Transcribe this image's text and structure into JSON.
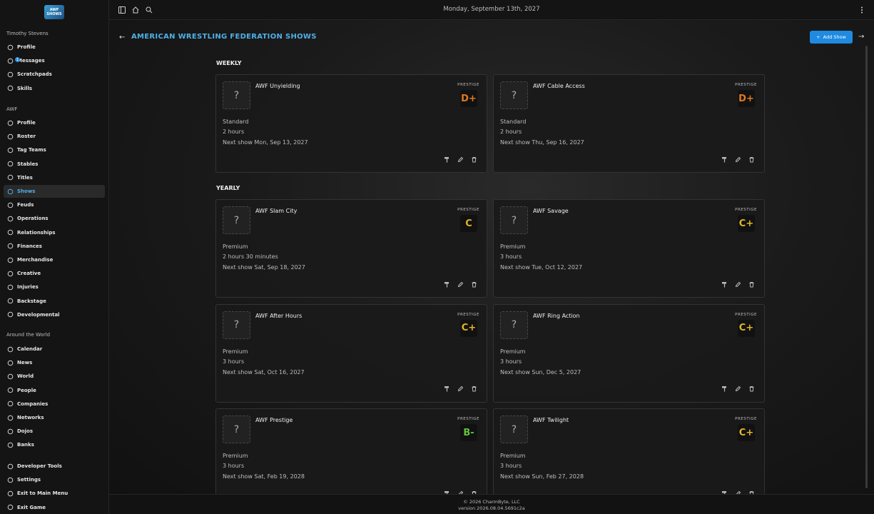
{
  "logo_text": "AWF SHOWS",
  "user_name": "Timothy Stevens",
  "user_nav": [
    {
      "icon": "person-icon",
      "label": "Profile"
    },
    {
      "icon": "chat-icon",
      "label": "Messages",
      "badge": "1"
    },
    {
      "icon": "notepad-icon",
      "label": "Scratchpads"
    },
    {
      "icon": "star-icon",
      "label": "Skills"
    }
  ],
  "org_section": "AWF",
  "org_nav": [
    {
      "icon": "person-icon",
      "label": "Profile"
    },
    {
      "icon": "list-icon",
      "label": "Roster"
    },
    {
      "icon": "tag-icon",
      "label": "Tag Teams"
    },
    {
      "icon": "group-icon",
      "label": "Stables"
    },
    {
      "icon": "belt-icon",
      "label": "Titles"
    },
    {
      "icon": "tv-icon",
      "label": "Shows",
      "active": true
    },
    {
      "icon": "fist-icon",
      "label": "Feuds"
    },
    {
      "icon": "gear-icon",
      "label": "Operations"
    },
    {
      "icon": "heart-icon",
      "label": "Relationships"
    },
    {
      "icon": "dollar-icon",
      "label": "Finances"
    },
    {
      "icon": "shirt-icon",
      "label": "Merchandise"
    },
    {
      "icon": "bulb-icon",
      "label": "Creative"
    },
    {
      "icon": "bandage-icon",
      "label": "Injuries"
    },
    {
      "icon": "door-icon",
      "label": "Backstage"
    },
    {
      "icon": "pencil-icon",
      "label": "Developmental"
    }
  ],
  "world_section": "Around the World",
  "world_nav": [
    {
      "icon": "calendar-icon",
      "label": "Calendar"
    },
    {
      "icon": "news-icon",
      "label": "News"
    },
    {
      "icon": "globe-icon",
      "label": "World"
    },
    {
      "icon": "person-icon",
      "label": "People"
    },
    {
      "icon": "building-icon",
      "label": "Companies"
    },
    {
      "icon": "antenna-icon",
      "label": "Networks"
    },
    {
      "icon": "dojo-icon",
      "label": "Dojos"
    },
    {
      "icon": "bank-icon",
      "label": "Banks"
    }
  ],
  "bottom_nav": [
    {
      "icon": "code-icon",
      "label": "Developer Tools"
    },
    {
      "icon": "gear-icon",
      "label": "Settings"
    },
    {
      "icon": "exit-icon",
      "label": "Exit to Main Menu"
    },
    {
      "icon": "power-icon",
      "label": "Exit Game"
    }
  ],
  "topbar": {
    "date": "Monday, September 13th, 2027"
  },
  "page": {
    "title": "AMERICAN WRESTLING FEDERATION SHOWS",
    "add_button": "Add Show"
  },
  "prestige_label": "PRESTIGE",
  "colors": {
    "accent": "#4fb0e8",
    "button": "#1f8ae0",
    "grade_d": "#e07a22",
    "grade_c": "#e0b52a",
    "grade_b": "#62c23a"
  },
  "groups": [
    {
      "title": "WEEKLY",
      "shows": [
        {
          "name": "AWF Unyielding",
          "grade": "D+",
          "grade_color": "#e07a22",
          "type": "Standard",
          "duration": "2 hours",
          "next": "Next show Mon, Sep 13, 2027"
        },
        {
          "name": "AWF Cable Access",
          "grade": "D+",
          "grade_color": "#e07a22",
          "type": "Standard",
          "duration": "2 hours",
          "next": "Next show Thu, Sep 16, 2027"
        }
      ]
    },
    {
      "title": "YEARLY",
      "shows": [
        {
          "name": "AWF Slam City",
          "grade": "C",
          "grade_color": "#e0b52a",
          "type": "Premium",
          "duration": "2 hours 30 minutes",
          "next": "Next show Sat, Sep 18, 2027"
        },
        {
          "name": "AWF Savage",
          "grade": "C+",
          "grade_color": "#e0b52a",
          "type": "Premium",
          "duration": "3 hours",
          "next": "Next show Tue, Oct 12, 2027"
        },
        {
          "name": "AWF After Hours",
          "grade": "C+",
          "grade_color": "#e0b52a",
          "type": "Premium",
          "duration": "3 hours",
          "next": "Next show Sat, Oct 16, 2027"
        },
        {
          "name": "AWF Ring Action",
          "grade": "C+",
          "grade_color": "#e0b52a",
          "type": "Premium",
          "duration": "3 hours",
          "next": "Next show Sun, Dec 5, 2027"
        },
        {
          "name": "AWF Prestige",
          "grade": "B-",
          "grade_color": "#62c23a",
          "type": "Premium",
          "duration": "3 hours",
          "next": "Next show Sat, Feb 19, 2028"
        },
        {
          "name": "AWF Twilight",
          "grade": "C+",
          "grade_color": "#e0b52a",
          "type": "Premium",
          "duration": "3 hours",
          "next": "Next show Sun, Feb 27, 2028"
        }
      ]
    }
  ],
  "footer": {
    "copyright": "© 2026 CharmByte, LLC",
    "version": "version 2026.08.04.5691c2a"
  }
}
